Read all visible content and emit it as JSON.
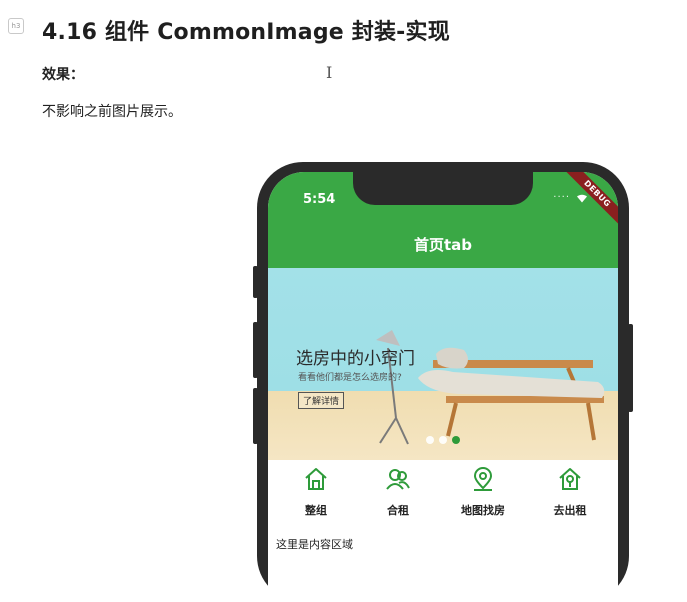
{
  "doc": {
    "heading_badge": "h3",
    "title": "4.16 组件 CommonImage 封装-实现",
    "effect_label": "效果：",
    "description": "不影响之前图片展示。"
  },
  "phone": {
    "status": {
      "time": "5:54",
      "debug_label": "DEBUG"
    },
    "appbar_title": "首页tab",
    "banner": {
      "title": "选房中的小窍门",
      "subtitle": "看看他们都是怎么选房的?",
      "button": "了解详情",
      "dot_count": 3,
      "active_dot_index": 2
    },
    "nav_items": [
      {
        "label": "整组",
        "icon": "house-icon"
      },
      {
        "label": "合租",
        "icon": "people-icon"
      },
      {
        "label": "地图找房",
        "icon": "map-pin-icon"
      },
      {
        "label": "去出租",
        "icon": "house-key-icon"
      }
    ],
    "content_text": "这里是内容区域"
  },
  "colors": {
    "appbar": "#3aa845",
    "icon_green": "#2e9b3a",
    "debug_ribbon": "#8b1f1f",
    "phone_frame": "#2a2a2a"
  }
}
